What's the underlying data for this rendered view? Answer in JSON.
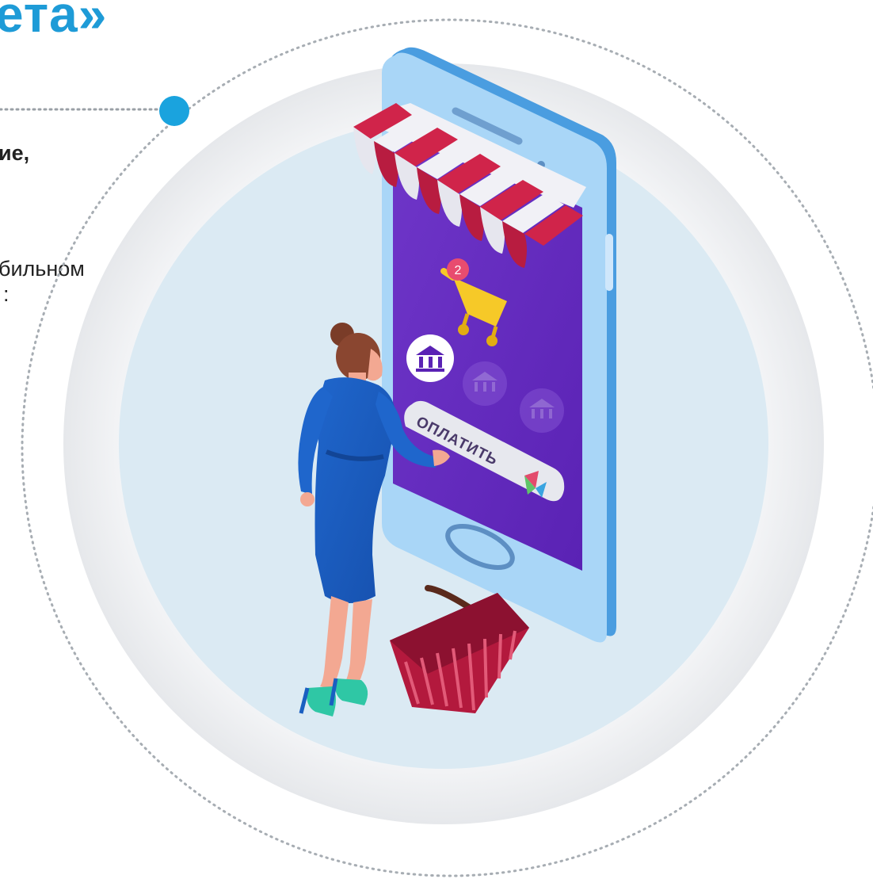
{
  "heading": {
    "title_fragment": "ета»"
  },
  "text_block": {
    "bold_fragment": "ие,",
    "body_line_1": "бильном",
    "body_line_2": ":"
  },
  "phone": {
    "pay_button_label": "ОПЛАТИТЬ",
    "cart_badge_count": "2"
  },
  "colors": {
    "accent_blue": "#1e9bd7",
    "phone_frame": "#5bb0ef",
    "phone_screen": "#6b2fc4",
    "awning_red": "#d0244a",
    "basket_red": "#b3193d",
    "dress_blue": "#1a5fc1",
    "shoe_teal": "#2fc7a5",
    "cart_yellow": "#f6c928",
    "circle_bg": "#dbeaf3"
  }
}
